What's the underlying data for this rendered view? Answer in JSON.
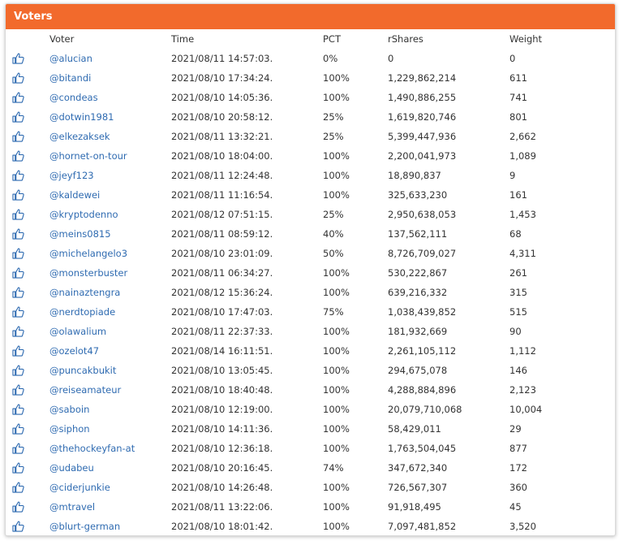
{
  "panel": {
    "title": "Voters"
  },
  "columns": {
    "voter": "Voter",
    "time": "Time",
    "pct": "PCT",
    "rshares": "rShares",
    "weight": "Weight"
  },
  "icon": "thumbs-up-icon",
  "accent_color": "#f26a2c",
  "link_color": "#2f6bb1",
  "rows": [
    {
      "voter": "@alucian",
      "time": "2021/08/11 14:57:03.",
      "pct": "0%",
      "rshares": "0",
      "weight": "0"
    },
    {
      "voter": "@bitandi",
      "time": "2021/08/10 17:34:24.",
      "pct": "100%",
      "rshares": "1,229,862,214",
      "weight": "611"
    },
    {
      "voter": "@condeas",
      "time": "2021/08/10 14:05:36.",
      "pct": "100%",
      "rshares": "1,490,886,255",
      "weight": "741"
    },
    {
      "voter": "@dotwin1981",
      "time": "2021/08/10 20:58:12.",
      "pct": "25%",
      "rshares": "1,619,820,746",
      "weight": "801"
    },
    {
      "voter": "@elkezaksek",
      "time": "2021/08/11 13:32:21.",
      "pct": "25%",
      "rshares": "5,399,447,936",
      "weight": "2,662"
    },
    {
      "voter": "@hornet-on-tour",
      "time": "2021/08/10 18:04:00.",
      "pct": "100%",
      "rshares": "2,200,041,973",
      "weight": "1,089"
    },
    {
      "voter": "@jeyf123",
      "time": "2021/08/11 12:24:48.",
      "pct": "100%",
      "rshares": "18,890,837",
      "weight": "9"
    },
    {
      "voter": "@kaldewei",
      "time": "2021/08/11 11:16:54.",
      "pct": "100%",
      "rshares": "325,633,230",
      "weight": "161"
    },
    {
      "voter": "@kryptodenno",
      "time": "2021/08/12 07:51:15.",
      "pct": "25%",
      "rshares": "2,950,638,053",
      "weight": "1,453"
    },
    {
      "voter": "@meins0815",
      "time": "2021/08/11 08:59:12.",
      "pct": "40%",
      "rshares": "137,562,111",
      "weight": "68"
    },
    {
      "voter": "@michelangelo3",
      "time": "2021/08/10 23:01:09.",
      "pct": "50%",
      "rshares": "8,726,709,027",
      "weight": "4,311"
    },
    {
      "voter": "@monsterbuster",
      "time": "2021/08/11 06:34:27.",
      "pct": "100%",
      "rshares": "530,222,867",
      "weight": "261"
    },
    {
      "voter": "@nainaztengra",
      "time": "2021/08/12 15:36:24.",
      "pct": "100%",
      "rshares": "639,216,332",
      "weight": "315"
    },
    {
      "voter": "@nerdtopiade",
      "time": "2021/08/10 17:47:03.",
      "pct": "75%",
      "rshares": "1,038,439,852",
      "weight": "515"
    },
    {
      "voter": "@olawalium",
      "time": "2021/08/11 22:37:33.",
      "pct": "100%",
      "rshares": "181,932,669",
      "weight": "90"
    },
    {
      "voter": "@ozelot47",
      "time": "2021/08/14 16:11:51.",
      "pct": "100%",
      "rshares": "2,261,105,112",
      "weight": "1,112"
    },
    {
      "voter": "@puncakbukit",
      "time": "2021/08/10 13:05:45.",
      "pct": "100%",
      "rshares": "294,675,078",
      "weight": "146"
    },
    {
      "voter": "@reiseamateur",
      "time": "2021/08/10 18:40:48.",
      "pct": "100%",
      "rshares": "4,288,884,896",
      "weight": "2,123"
    },
    {
      "voter": "@saboin",
      "time": "2021/08/10 12:19:00.",
      "pct": "100%",
      "rshares": "20,079,710,068",
      "weight": "10,004"
    },
    {
      "voter": "@siphon",
      "time": "2021/08/10 14:11:36.",
      "pct": "100%",
      "rshares": "58,429,011",
      "weight": "29"
    },
    {
      "voter": "@thehockeyfan-at",
      "time": "2021/08/10 12:36:18.",
      "pct": "100%",
      "rshares": "1,763,504,045",
      "weight": "877"
    },
    {
      "voter": "@udabeu",
      "time": "2021/08/10 20:16:45.",
      "pct": "74%",
      "rshares": "347,672,340",
      "weight": "172"
    },
    {
      "voter": "@ciderjunkie",
      "time": "2021/08/10 14:26:48.",
      "pct": "100%",
      "rshares": "726,567,307",
      "weight": "360"
    },
    {
      "voter": "@mtravel",
      "time": "2021/08/11 13:22:06.",
      "pct": "100%",
      "rshares": "91,918,495",
      "weight": "45"
    },
    {
      "voter": "@blurt-german",
      "time": "2021/08/10 18:01:42.",
      "pct": "100%",
      "rshares": "7,097,481,852",
      "weight": "3,520"
    }
  ]
}
